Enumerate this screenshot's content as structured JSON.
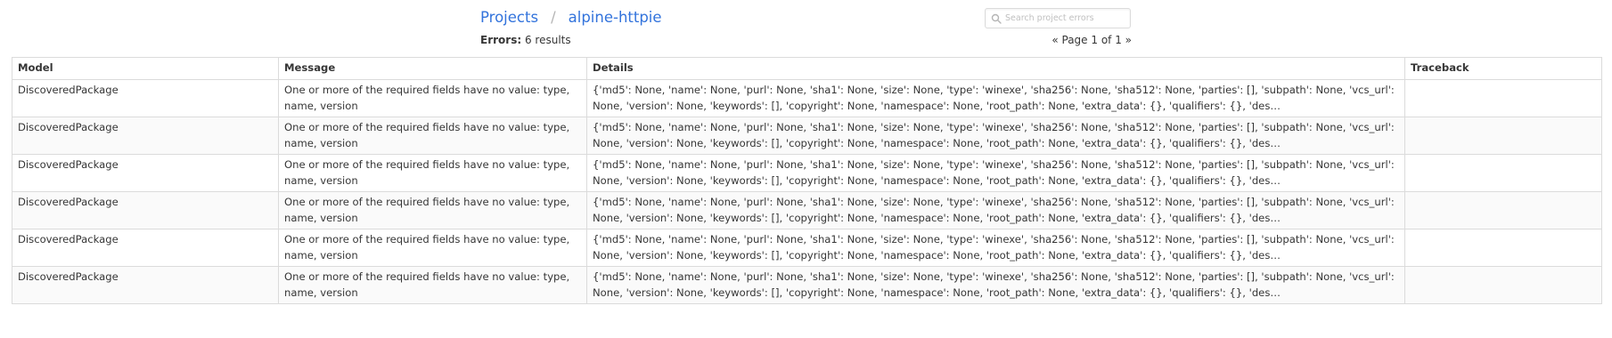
{
  "breadcrumb": {
    "projects": "Projects",
    "separator": "/",
    "project": "alpine-httpie"
  },
  "search": {
    "placeholder": "Search project errors",
    "value": ""
  },
  "summary": {
    "label": "Errors:",
    "count": "6 results"
  },
  "pager": {
    "text": "« Page 1 of 1 »"
  },
  "table": {
    "headers": [
      "Model",
      "Message",
      "Details",
      "Traceback"
    ],
    "rows": [
      {
        "model": "DiscoveredPackage",
        "message": "One or more of the required fields have no value: type, name, version",
        "details": "{'md5': None, 'name': None, 'purl': None, 'sha1': None, 'size': None, 'type': 'winexe', 'sha256': None, 'sha512': None, 'parties': [], 'subpath': None, 'vcs_url': None, 'version': None, 'keywords': [], 'copyright': None, 'namespace': None, 'root_path': None, 'extra_data': {}, 'qualifiers': {}, 'des…",
        "traceback": ""
      },
      {
        "model": "DiscoveredPackage",
        "message": "One or more of the required fields have no value: type, name, version",
        "details": "{'md5': None, 'name': None, 'purl': None, 'sha1': None, 'size': None, 'type': 'winexe', 'sha256': None, 'sha512': None, 'parties': [], 'subpath': None, 'vcs_url': None, 'version': None, 'keywords': [], 'copyright': None, 'namespace': None, 'root_path': None, 'extra_data': {}, 'qualifiers': {}, 'des…",
        "traceback": ""
      },
      {
        "model": "DiscoveredPackage",
        "message": "One or more of the required fields have no value: type, name, version",
        "details": "{'md5': None, 'name': None, 'purl': None, 'sha1': None, 'size': None, 'type': 'winexe', 'sha256': None, 'sha512': None, 'parties': [], 'subpath': None, 'vcs_url': None, 'version': None, 'keywords': [], 'copyright': None, 'namespace': None, 'root_path': None, 'extra_data': {}, 'qualifiers': {}, 'des…",
        "traceback": ""
      },
      {
        "model": "DiscoveredPackage",
        "message": "One or more of the required fields have no value: type, name, version",
        "details": "{'md5': None, 'name': None, 'purl': None, 'sha1': None, 'size': None, 'type': 'winexe', 'sha256': None, 'sha512': None, 'parties': [], 'subpath': None, 'vcs_url': None, 'version': None, 'keywords': [], 'copyright': None, 'namespace': None, 'root_path': None, 'extra_data': {}, 'qualifiers': {}, 'des…",
        "traceback": ""
      },
      {
        "model": "DiscoveredPackage",
        "message": "One or more of the required fields have no value: type, name, version",
        "details": "{'md5': None, 'name': None, 'purl': None, 'sha1': None, 'size': None, 'type': 'winexe', 'sha256': None, 'sha512': None, 'parties': [], 'subpath': None, 'vcs_url': None, 'version': None, 'keywords': [], 'copyright': None, 'namespace': None, 'root_path': None, 'extra_data': {}, 'qualifiers': {}, 'des…",
        "traceback": ""
      },
      {
        "model": "DiscoveredPackage",
        "message": "One or more of the required fields have no value: type, name, version",
        "details": "{'md5': None, 'name': None, 'purl': None, 'sha1': None, 'size': None, 'type': 'winexe', 'sha256': None, 'sha512': None, 'parties': [], 'subpath': None, 'vcs_url': None, 'version': None, 'keywords': [], 'copyright': None, 'namespace': None, 'root_path': None, 'extra_data': {}, 'qualifiers': {}, 'des…",
        "traceback": ""
      }
    ]
  },
  "icons": {
    "search": "search-icon"
  },
  "colors": {
    "link": "#3273dc",
    "border": "#dbdbdb",
    "text": "#363636"
  }
}
